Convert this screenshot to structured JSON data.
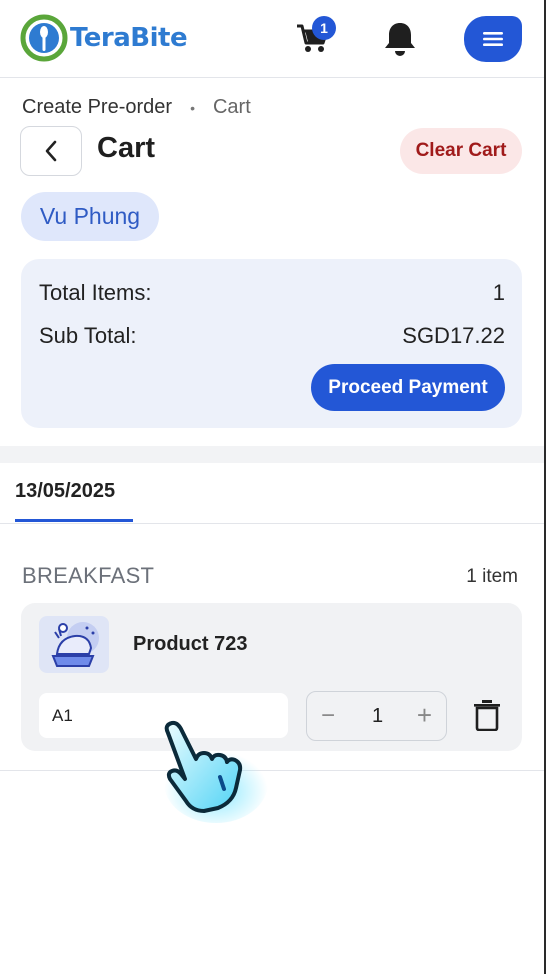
{
  "header": {
    "logo_text_a": "Tera",
    "logo_text_b": "Bite",
    "cart_count": "1"
  },
  "breadcrumb": {
    "parent": "Create Pre-order",
    "separator": "•",
    "current": "Cart"
  },
  "page": {
    "title": "Cart",
    "clear_label": "Clear Cart",
    "customer": "Vu Phung"
  },
  "summary": {
    "total_items_label": "Total Items:",
    "total_items_value": "1",
    "subtotal_label": "Sub Total:",
    "subtotal_value": "SGD17.22",
    "proceed_label": "Proceed Payment"
  },
  "tabs": {
    "date": "13/05/2025"
  },
  "meal": {
    "label": "BREAKFAST",
    "count": "1 item"
  },
  "item": {
    "name": "Product 723",
    "note": "A1",
    "qty": "1",
    "minus": "−",
    "plus": "+"
  },
  "colors": {
    "primary": "#2357d6",
    "danger_bg": "#fbe7e7",
    "danger_text": "#a01b1b"
  }
}
